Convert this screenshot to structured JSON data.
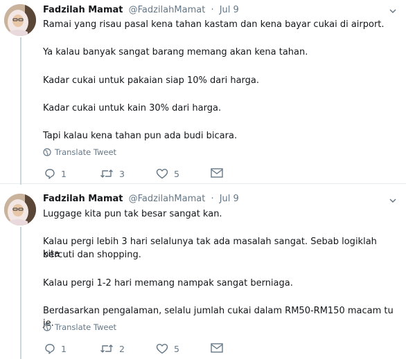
{
  "tweets": [
    {
      "name": "Fadzilah Mamat",
      "handle": "@FadzilahMamat",
      "sep": "·",
      "date": "Jul 9",
      "lines": [
        "Ramai yang risau pasal kena tahan kastam dan kena bayar cukai di airport.",
        "Ya kalau banyak sangat barang memang akan kena tahan.",
        "Kadar cukai untuk pakaian siap 10% dari harga.",
        "Kadar cukai untuk kain 30% dari harga.",
        "Tapi kalau kena tahan pun ada budi bicara."
      ],
      "translate_label": "Translate Tweet",
      "reply_count": "1",
      "retweet_count": "3",
      "like_count": "5"
    },
    {
      "name": "Fadzilah Mamat",
      "handle": "@FadzilahMamat",
      "sep": "·",
      "date": "Jul 9",
      "lines": [
        "Luggage kita pun tak besar sangat kan.",
        "Kalau pergi lebih 3 hari selalunya tak ada masalah sangat. Sebab logiklah kita",
        "bercuti dan shopping.",
        "Kalau pergi 1-2 hari memang nampak sangat berniaga.",
        "Berdasarkan pengalaman, selalu jumlah cukai dalam RM50-RM150 macam tu je."
      ],
      "translate_label": "Translate Tweet",
      "reply_count": "1",
      "retweet_count": "2",
      "like_count": "5"
    }
  ],
  "icons": {
    "more": "chevron-down-icon",
    "translate": "globe-icon",
    "reply": "reply-icon",
    "retweet": "retweet-icon",
    "like": "heart-icon",
    "dm": "envelope-icon"
  },
  "colors": {
    "text": "#14171a",
    "secondary": "#657786",
    "thread_line": "#ccd6dd",
    "divider": "#e6ecf0"
  }
}
